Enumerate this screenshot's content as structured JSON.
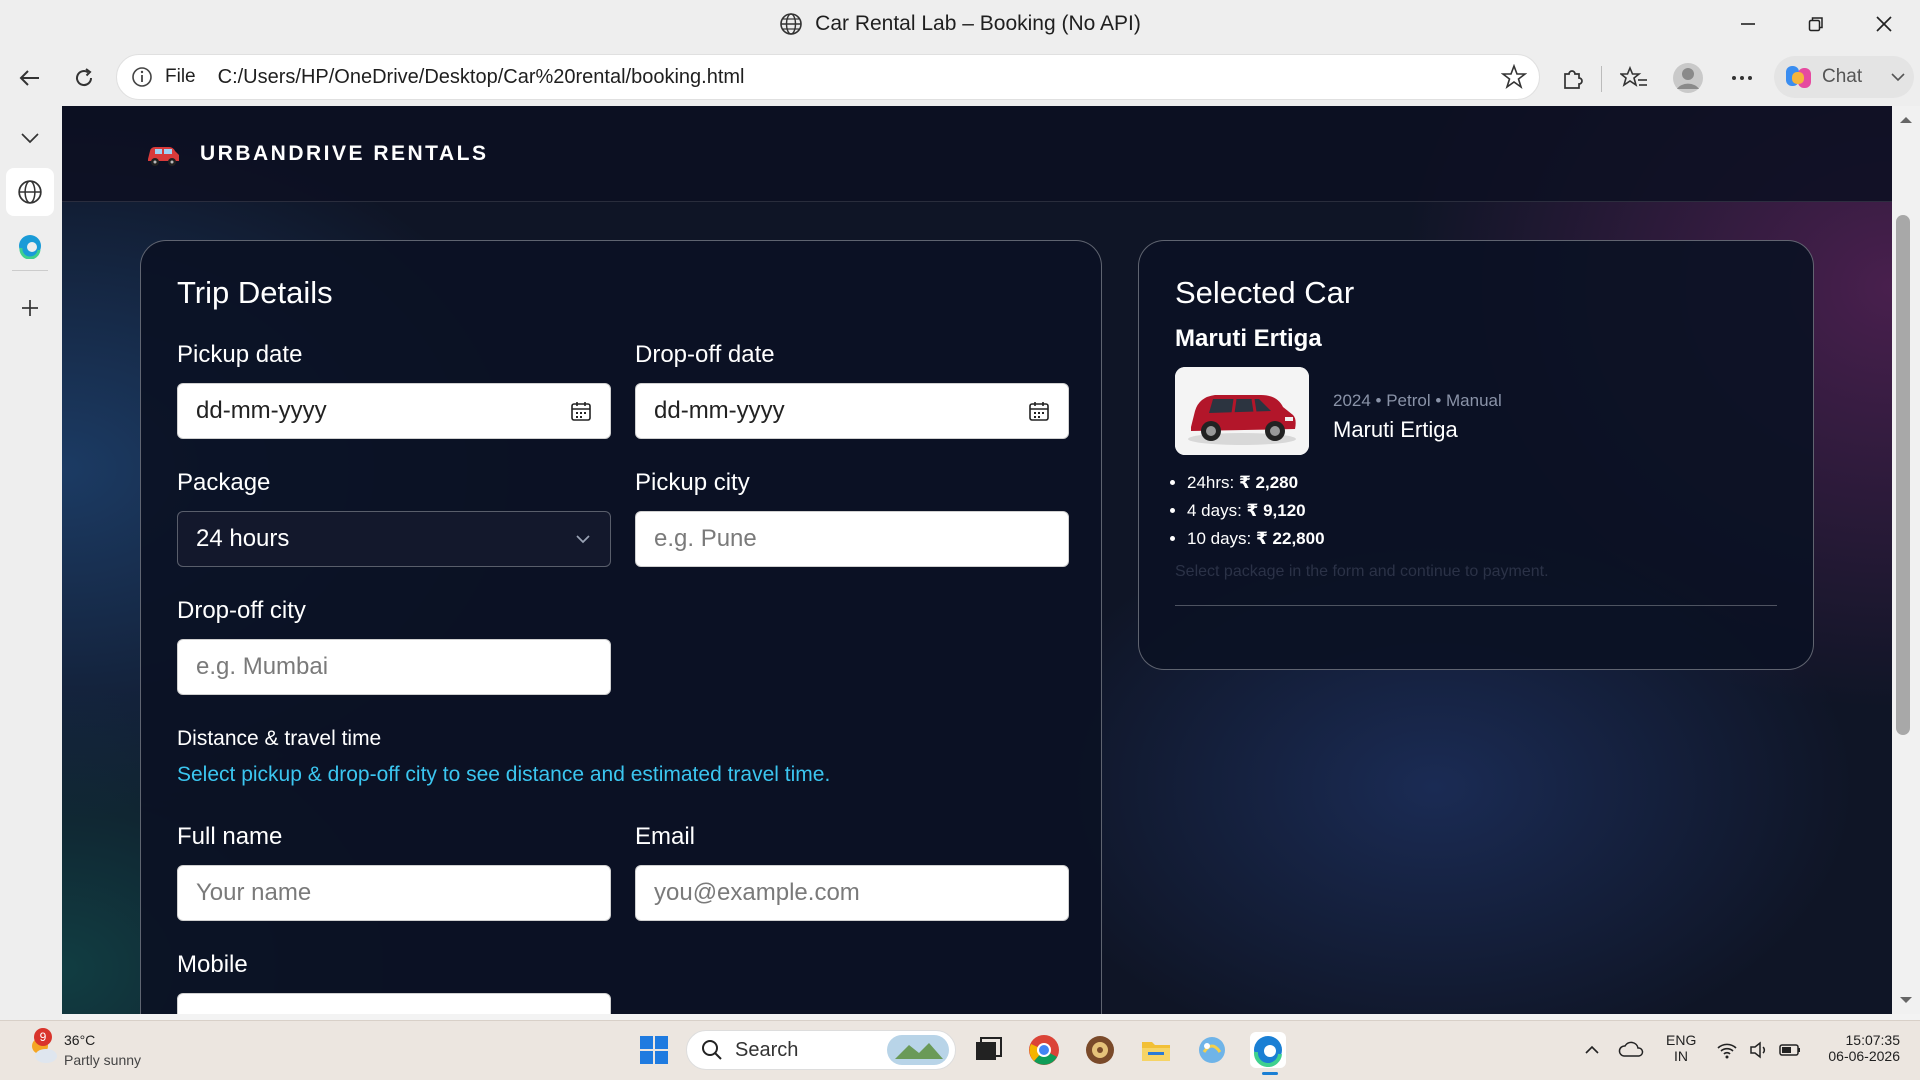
{
  "browser": {
    "window_title": "Car Rental Lab – Booking (No API)",
    "address_prefix": "File",
    "url": "C:/Users/HP/OneDrive/Desktop/Car%20rental/booking.html",
    "chat_label": "Chat"
  },
  "site": {
    "brand": "URBANDRIVE RENTALS"
  },
  "trip": {
    "title": "Trip Details",
    "pickup_date_label": "Pickup date",
    "pickup_date_value": "dd-mm-yyyy",
    "dropoff_date_label": "Drop-off date",
    "dropoff_date_value": "dd-mm-yyyy",
    "package_label": "Package",
    "package_value": "24 hours",
    "pickup_city_label": "Pickup city",
    "pickup_city_placeholder": "e.g. Pune",
    "dropoff_city_label": "Drop-off city",
    "dropoff_city_placeholder": "e.g. Mumbai",
    "distance_label": "Distance & travel time",
    "distance_hint": "Select pickup & drop-off city to see distance and estimated travel time.",
    "fullname_label": "Full name",
    "fullname_placeholder": "Your name",
    "email_label": "Email",
    "email_placeholder": "you@example.com",
    "mobile_label": "Mobile"
  },
  "selected_car": {
    "title": "Selected Car",
    "name": "Maruti Ertiga",
    "meta": "2024 • Petrol • Manual",
    "card_name": "Maruti Ertiga",
    "prices": [
      {
        "label": "24hrs: ",
        "value": "₹ 2,280"
      },
      {
        "label": "4 days: ",
        "value": "₹ 9,120"
      },
      {
        "label": "10 days: ",
        "value": "₹ 22,800"
      }
    ],
    "note": "Select package in the form and continue to payment."
  },
  "taskbar": {
    "weather_temp": "36°C",
    "weather_desc": "Partly sunny",
    "weather_badge": "9",
    "search_label": "Search",
    "lang_top": "ENG",
    "lang_bottom": "IN",
    "time": "15:07:35",
    "date": "06-06-2026"
  }
}
